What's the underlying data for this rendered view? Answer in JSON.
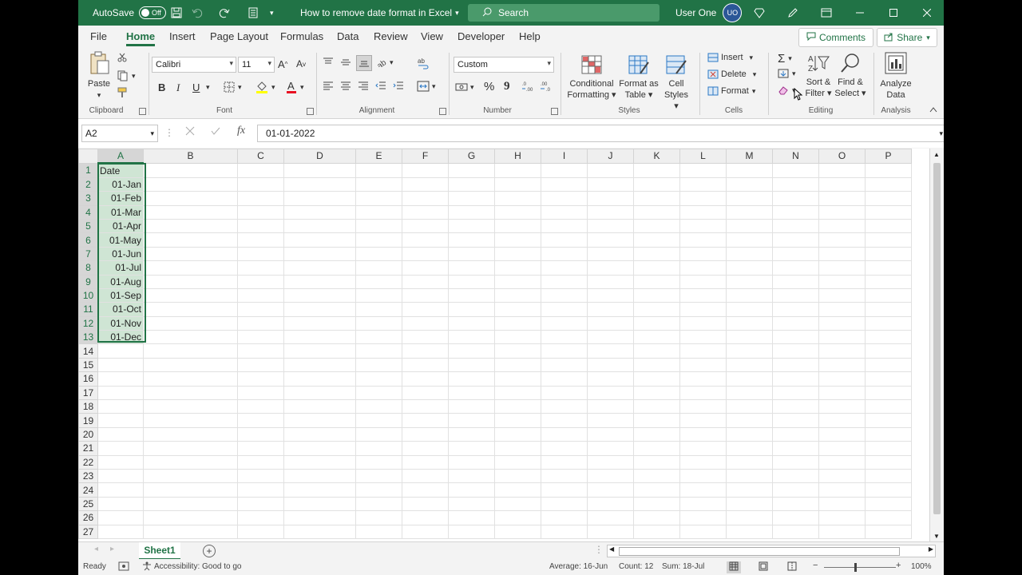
{
  "titlebar": {
    "autosave_label": "AutoSave",
    "autosave_state": "Off",
    "doc_title": "How to remove date format in Excel",
    "search_placeholder": "Search",
    "user_name": "User One",
    "user_initials": "UO"
  },
  "tabs": [
    "File",
    "Home",
    "Insert",
    "Page Layout",
    "Formulas",
    "Data",
    "Review",
    "View",
    "Developer",
    "Help"
  ],
  "active_tab": "Home",
  "comments_label": "Comments",
  "share_label": "Share",
  "ribbon": {
    "clipboard": {
      "paste": "Paste",
      "label": "Clipboard"
    },
    "font": {
      "name": "Calibri",
      "size": "11",
      "label": "Font",
      "bold": "B",
      "italic": "I",
      "underline": "U",
      "grow": "A",
      "shrink": "A"
    },
    "alignment": {
      "label": "Alignment"
    },
    "number": {
      "format": "Custom",
      "label": "Number",
      "percent": "%",
      "comma": "9"
    },
    "styles": {
      "conditional": "Conditional",
      "conditional2": "Formatting",
      "format_table": "Format as",
      "format_table2": "Table",
      "cell_styles": "Cell",
      "cell_styles2": "Styles",
      "label": "Styles"
    },
    "cells": {
      "insert": "Insert",
      "delete": "Delete",
      "format": "Format",
      "label": "Cells"
    },
    "editing": {
      "sort": "Sort &",
      "sort2": "Filter",
      "find": "Find &",
      "find2": "Select",
      "label": "Editing"
    },
    "analysis": {
      "analyze": "Analyze",
      "analyze2": "Data",
      "label": "Analysis"
    }
  },
  "formula_bar": {
    "name_box": "A2",
    "formula": "01-01-2022",
    "fx": "fx"
  },
  "columns": [
    "A",
    "B",
    "C",
    "D",
    "E",
    "F",
    "G",
    "H",
    "I",
    "J",
    "K",
    "L",
    "M",
    "N",
    "O",
    "P"
  ],
  "rows": [
    "1",
    "2",
    "3",
    "4",
    "5",
    "6",
    "7",
    "8",
    "9",
    "10",
    "11",
    "12",
    "13",
    "14",
    "15",
    "16",
    "17",
    "18",
    "19",
    "20",
    "21",
    "22",
    "23",
    "24",
    "25",
    "26",
    "27"
  ],
  "cells": {
    "A1": "Date",
    "A2": "01-Jan",
    "A3": "01-Feb",
    "A4": "01-Mar",
    "A5": "01-Apr",
    "A6": "01-May",
    "A7": "01-Jun",
    "A8": "01-Jul",
    "A9": "01-Aug",
    "A10": "01-Sep",
    "A11": "01-Oct",
    "A12": "01-Nov",
    "A13": "01-Dec"
  },
  "sheet_tab": "Sheet1",
  "status": {
    "ready": "Ready",
    "accessibility": "Accessibility: Good to go",
    "average": "Average: 16-Jun",
    "count": "Count: 12",
    "sum": "Sum: 18-Jul",
    "zoom": "100%"
  },
  "colors": {
    "accent": "#217346",
    "selection": "#cfe5d4"
  }
}
